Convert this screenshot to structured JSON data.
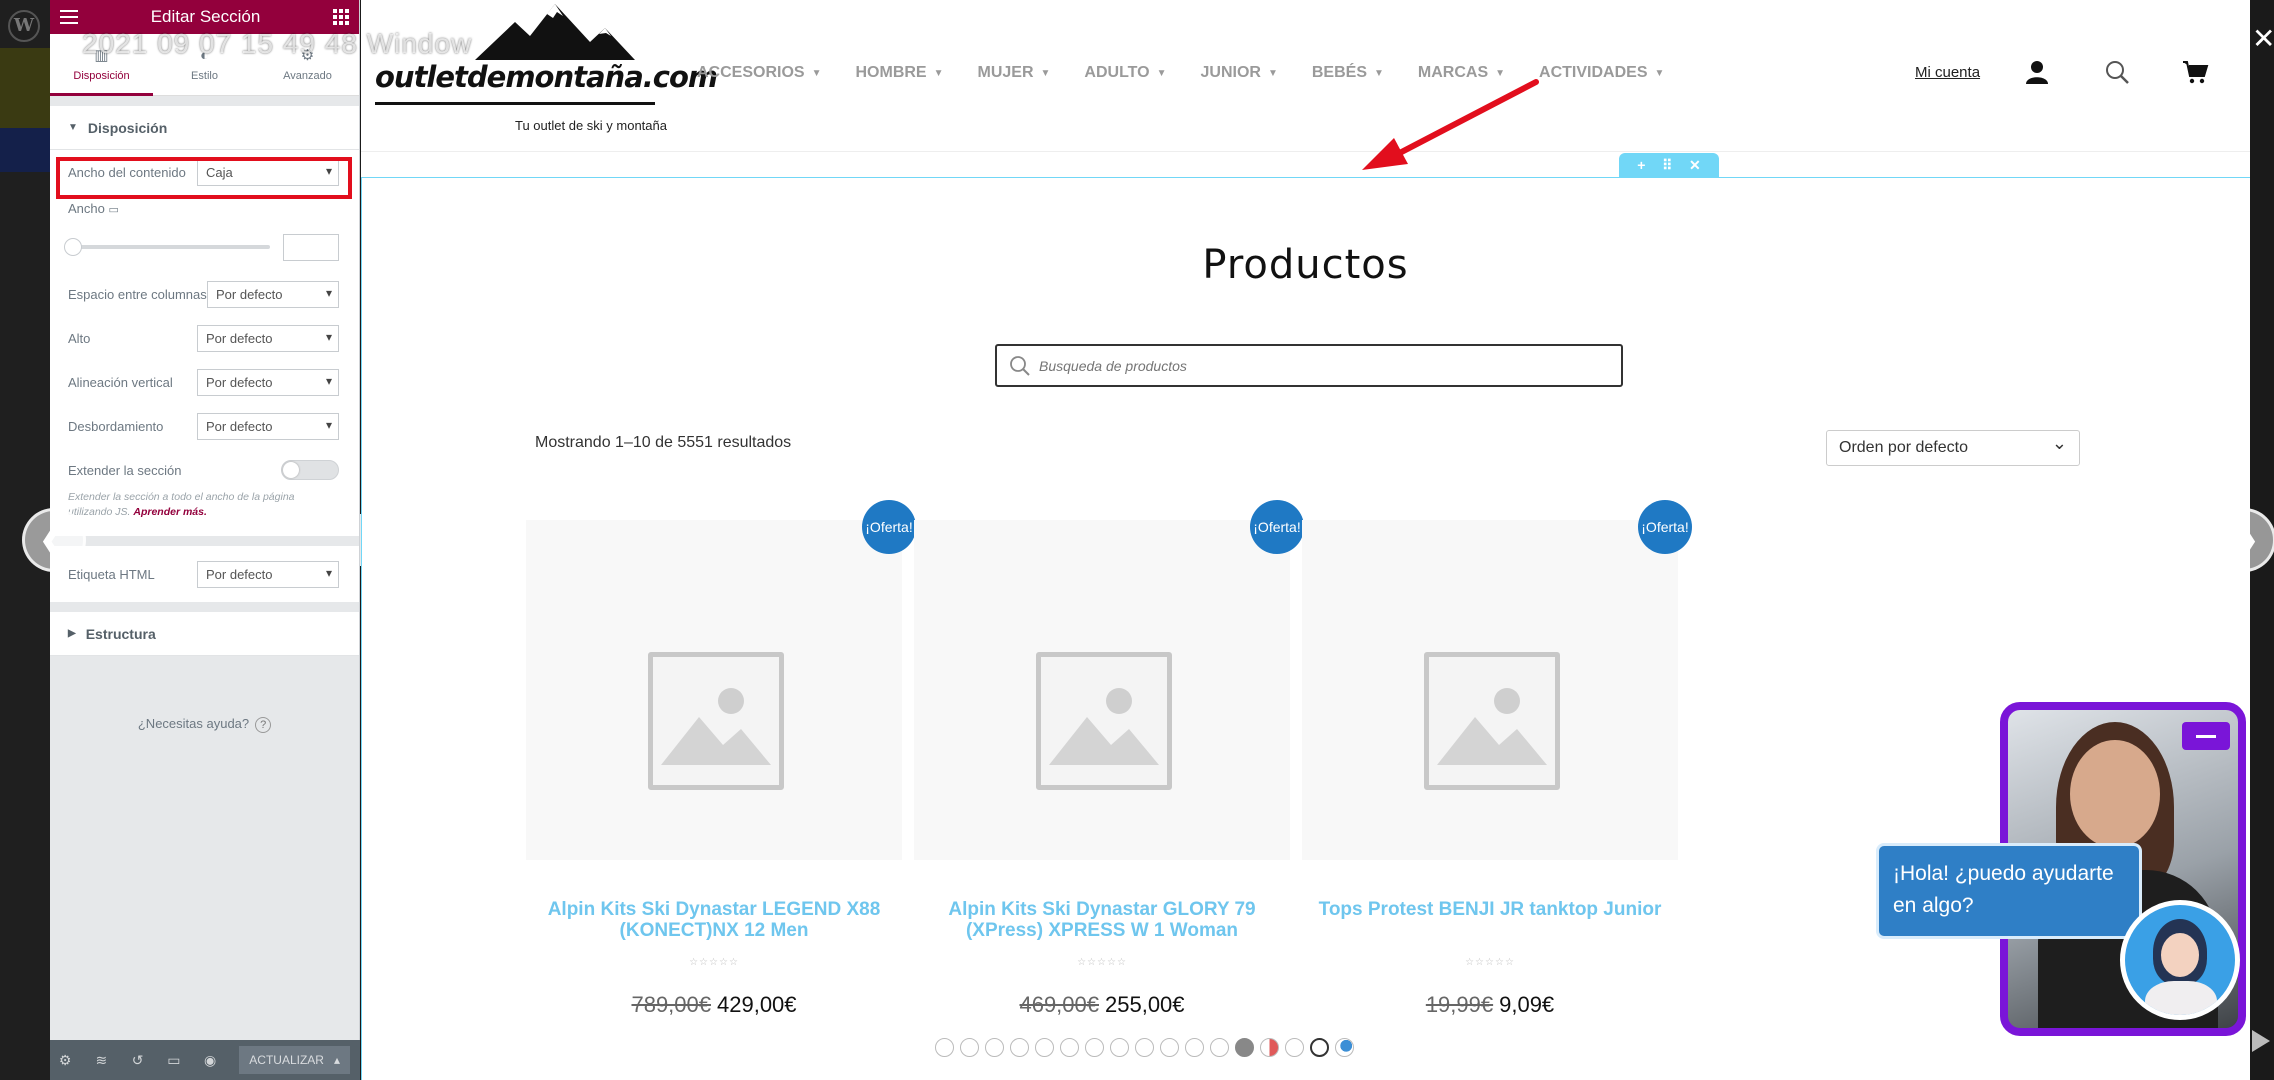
{
  "watermark": "2021 09 07 15 49 48 Window",
  "colors": {
    "elementor": "#93003c",
    "accent_blue": "#71d7f7",
    "badge": "#1f79c4",
    "chat_purple": "#7a15d8",
    "highlight_red": "#e20e1d"
  },
  "panel": {
    "title": "Editar Sección",
    "tabs": [
      {
        "label": "Disposición",
        "icon": "layout-icon"
      },
      {
        "label": "Estilo",
        "icon": "style-icon"
      },
      {
        "label": "Avanzado",
        "icon": "gear-icon"
      }
    ],
    "section_layout": "Disposición",
    "controls": {
      "content_width_label": "Ancho del contenido",
      "content_width_value": "Caja",
      "width_label": "Ancho",
      "column_gap_label": "Espacio entre columnas",
      "column_gap_value": "Por defecto",
      "height_label": "Alto",
      "height_value": "Por defecto",
      "valign_label": "Alineación vertical",
      "valign_value": "Por defecto",
      "overflow_label": "Desbordamiento",
      "overflow_value": "Por defecto",
      "stretch_label": "Extender la sección",
      "stretch_note": "Extender la sección a todo el ancho de la página utilizando JS.",
      "stretch_link": "Aprender más.",
      "html_tag_label": "Etiqueta HTML",
      "html_tag_value": "Por defecto"
    },
    "section_structure": "Estructura",
    "help": "¿Necesitas ayuda?",
    "footer_update": "ACTUALIZAR"
  },
  "site": {
    "logo_text": "outletdemontaña.com",
    "logo_tagline": "Tu outlet de ski y montaña",
    "nav": [
      "ACCESORIOS",
      "HOMBRE",
      "MUJER",
      "ADULTO",
      "JUNIOR",
      "BEBÉS",
      "MARCAS",
      "ACTIVIDADES"
    ],
    "account": "Mi cuenta",
    "page_title": "Productos",
    "search_placeholder": "Busqueda de productos",
    "results": "Mostrando 1–10 de 5551 resultados",
    "orderby": "Orden por defecto",
    "products": [
      {
        "badge": "¡Oferta!",
        "title": "Alpin Kits Ski Dynastar LEGEND X88 (KONECT)NX 12 Men",
        "old_price": "789,00€",
        "price": "429,00€",
        "stars": "☆☆☆☆☆"
      },
      {
        "badge": "¡Oferta!",
        "title": "Alpin Kits Ski Dynastar GLORY 79 (XPress) XPRESS W 1 Woman",
        "old_price": "469,00€",
        "price": "255,00€",
        "stars": "☆☆☆☆☆"
      },
      {
        "badge": "¡Oferta!",
        "title": "Tops Protest BENJI JR tanktop Junior",
        "old_price": "19,99€",
        "price": "9,09€",
        "stars": "☆☆☆☆☆"
      }
    ]
  },
  "chat": {
    "greeting": "¡Hola! ¿puedo ayudarte en algo?"
  }
}
